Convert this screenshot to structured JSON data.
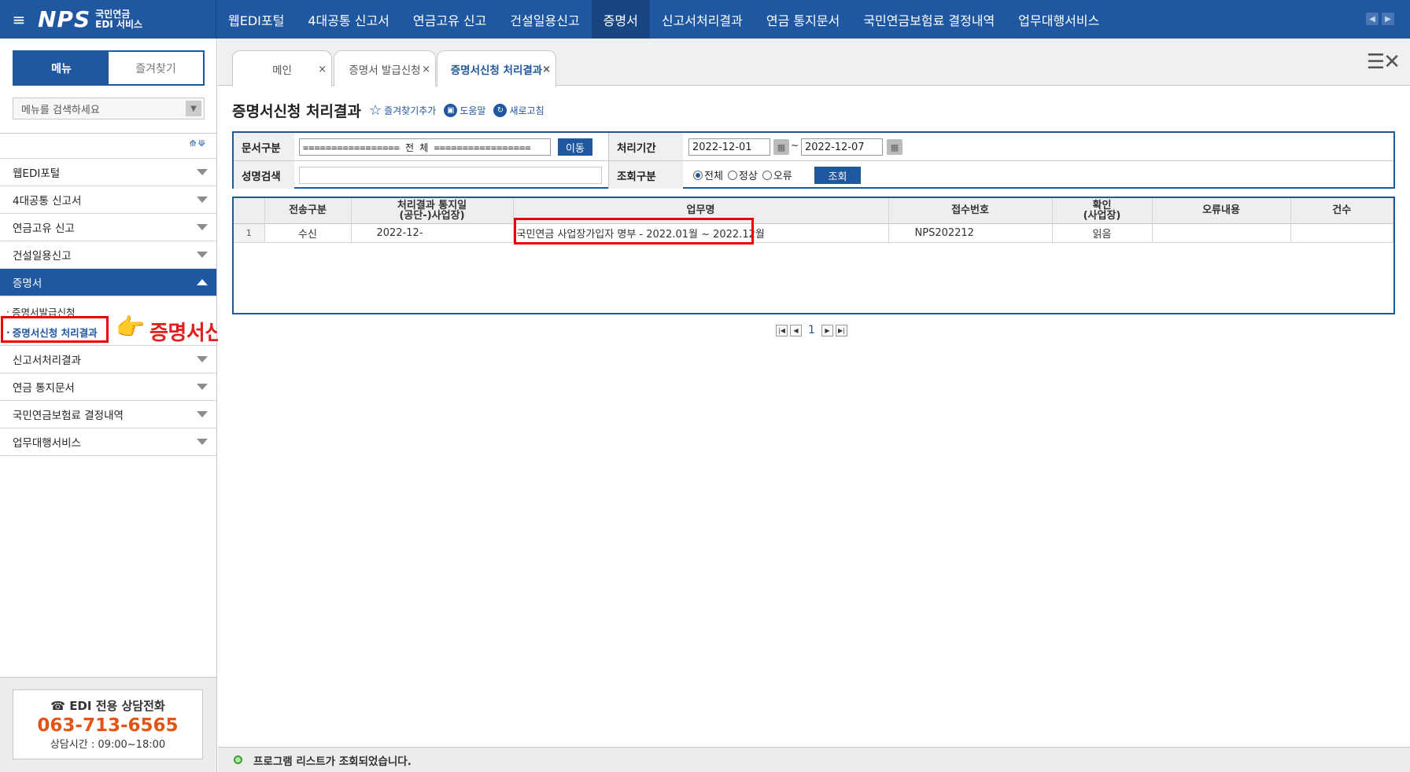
{
  "topbar": {
    "menu_icon": "hamburger-icon",
    "logo_mark": "NPS",
    "logo_line1": "국민연금",
    "logo_line2": "EDI 서비스",
    "nav": [
      "웹EDI포털",
      "4대공통 신고서",
      "연금고유 신고",
      "건설일용신고",
      "증명서",
      "신고서처리결과",
      "연금 통지문서",
      "국민연금보험료 결정내역",
      "업무대행서비스"
    ],
    "active_nav": "증명서"
  },
  "sidebar": {
    "tabs": [
      "메뉴",
      "즐겨찾기"
    ],
    "search_placeholder": "메뉴를 검색하세요",
    "items": [
      {
        "label": "웹EDI포털"
      },
      {
        "label": "4대공통 신고서"
      },
      {
        "label": "연금고유 신고"
      },
      {
        "label": "건설일용신고"
      },
      {
        "label": "증명서",
        "open": true
      },
      {
        "label": "신고서처리결과"
      },
      {
        "label": "연금 통지문서"
      },
      {
        "label": "국민연금보험료 결정내역"
      },
      {
        "label": "업무대행서비스"
      }
    ],
    "sub_items": [
      "증명서발급신청",
      "증명서신청 처리결과"
    ],
    "annotation": "증명서신청 처리결과",
    "call": {
      "title": "☎ EDI 전용 상담전화",
      "number": "063-713-6565",
      "hours": "상담시간 : 09:00~18:00"
    }
  },
  "tabs": [
    {
      "label": "메인"
    },
    {
      "label": "증명서 발급신청"
    },
    {
      "label": "증명서신청 처리결과",
      "active": true
    }
  ],
  "page": {
    "title": "증명서신청 처리결과",
    "fav_link": "즐겨찾기추가",
    "help_link": "도움말",
    "refresh_link": "새로고침"
  },
  "filter": {
    "doc_type_label": "문서구분",
    "doc_type_value": "================= 전 체 =================",
    "go_button": "이동",
    "period_label": "처리기간",
    "date_from": "2022-12-01",
    "date_sep": "~",
    "date_to": "2022-12-07",
    "name_label": "성명검색",
    "query_type_label": "조회구분",
    "radio_all": "전체",
    "radio_normal": "정상",
    "radio_error": "오류",
    "search_button": "조회"
  },
  "grid": {
    "headers": [
      "",
      "전송구분",
      "처리결과 통지일\n(공단-)사업장)",
      "업무명",
      "접수번호",
      "확인\n(사업장)",
      "오류내용",
      "건수"
    ],
    "rows": [
      {
        "no": "1",
        "type": "수신",
        "date": "2022-12-",
        "task": "국민연금 사업장가입자 명부 - 2022.01월 ~ 2022.12월",
        "receipt": "NPS202212",
        "confirm": "읽음",
        "error": "",
        "count": ""
      }
    ]
  },
  "pager": {
    "current": "1"
  },
  "status": {
    "message": "프로그램 리스트가 조회되었습니다."
  }
}
